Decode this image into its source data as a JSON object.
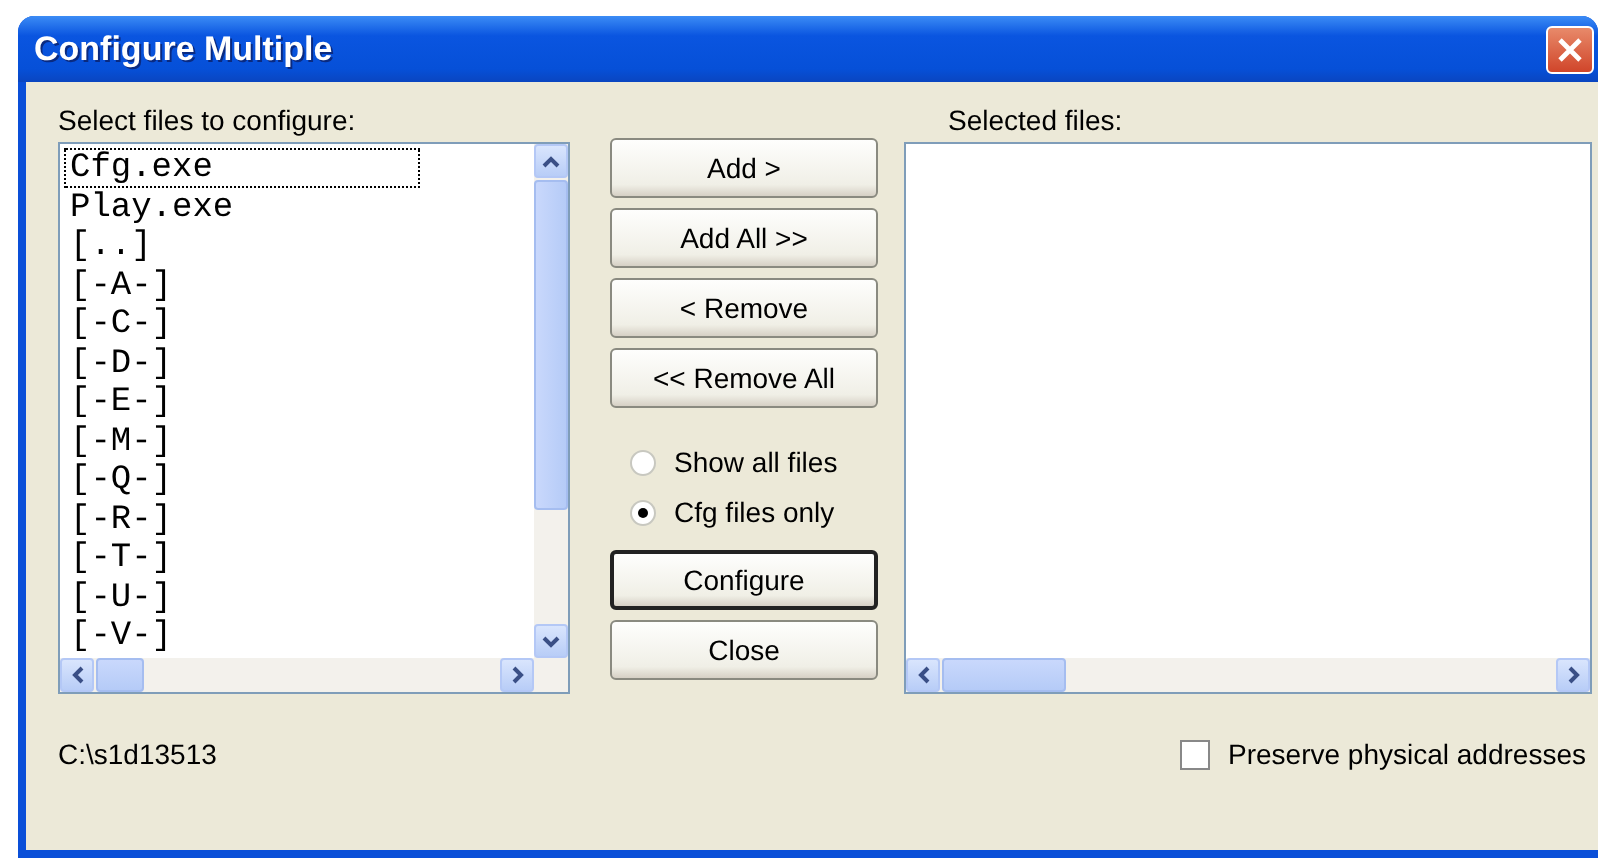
{
  "window": {
    "title": "Configure Multiple"
  },
  "source": {
    "label": "Select files to configure:",
    "items": [
      {
        "text": "Cfg.exe",
        "selected": true
      },
      {
        "text": "Play.exe",
        "selected": false
      },
      {
        "text": "[..]",
        "selected": false
      },
      {
        "text": "[-A-]",
        "selected": false
      },
      {
        "text": "[-C-]",
        "selected": false
      },
      {
        "text": "[-D-]",
        "selected": false
      },
      {
        "text": "[-E-]",
        "selected": false
      },
      {
        "text": "[-M-]",
        "selected": false
      },
      {
        "text": "[-Q-]",
        "selected": false
      },
      {
        "text": "[-R-]",
        "selected": false
      },
      {
        "text": "[-T-]",
        "selected": false
      },
      {
        "text": "[-U-]",
        "selected": false
      },
      {
        "text": "[-V-]",
        "selected": false
      }
    ]
  },
  "buttons": [
    {
      "label": "Add >",
      "default": false
    },
    {
      "label": "Add All >>",
      "default": false
    },
    {
      "label": "< Remove",
      "default": false
    },
    {
      "label": "<< Remove All",
      "default": false
    }
  ],
  "filter": [
    {
      "label": "Show all files",
      "selected": false
    },
    {
      "label": "Cfg files only",
      "selected": true
    }
  ],
  "actions": [
    {
      "label": "Configure",
      "default": true
    },
    {
      "label": "Close",
      "default": false
    }
  ],
  "target": {
    "label": "Selected files:"
  },
  "path": "C:\\s1d13513",
  "preserve": {
    "label": "Preserve physical addresses",
    "checked": false
  }
}
